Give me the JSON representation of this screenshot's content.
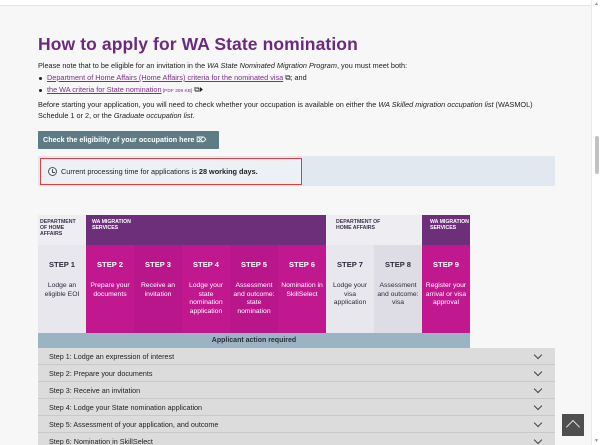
{
  "page": {
    "title": "How to apply for WA State nomination",
    "intro_text_1": "Please note that to be eligible for an invitation in the ",
    "intro_program": "WA State Nominated Migration Program",
    "intro_text_2": ", you must meet both:",
    "bullets": [
      {
        "link": "Department of Home Affairs (Home Affairs) criteria for the nominated visa",
        "suffix": " ⧉; and"
      },
      {
        "link": "the WA criteria for State nomination",
        "small": " [PDF 309 KB]",
        "suffix": " ⧉⏵"
      }
    ],
    "para2_a": "Before starting your application, you will need to check whether your occupation is available on either the ",
    "para2_list": "WA Skilled migration occupation list",
    "para2_b": " (WASMOL) Schedule 1 or 2, or the ",
    "para2_grad": "Graduate occupation list",
    "para2_c": ".",
    "check_button": "Check the eligibility of your occupation here ⌦",
    "processing_prefix": "Current processing time for applications is ",
    "processing_value": "28 working days."
  },
  "diagram": {
    "bands": [
      {
        "label": "DEPARTMENT OF HOME AFFAIRS"
      },
      {
        "label": "WA MIGRATION SERVICES"
      },
      {
        "label": "DEPARTMENT OF HOME AFFAIRS"
      },
      {
        "label": "WA MIGRATION SERVICES"
      }
    ],
    "steps": [
      {
        "step": "STEP 1",
        "desc": "Lodge an eligible EOI"
      },
      {
        "step": "STEP 2",
        "desc": "Prepare your documents"
      },
      {
        "step": "STEP 3",
        "desc": "Receive an invitation"
      },
      {
        "step": "STEP 4",
        "desc": "Lodge your state nomination application"
      },
      {
        "step": "STEP 5",
        "desc": "Assessment and outcome: state nomination"
      },
      {
        "step": "STEP 6",
        "desc": "Nomination in SkillSelect"
      },
      {
        "step": "STEP 7",
        "desc": "Lodge your visa application"
      },
      {
        "step": "STEP 8",
        "desc": "Assessment and outcome: visa"
      },
      {
        "step": "STEP 9",
        "desc": "Register your arrival or visa approval"
      }
    ],
    "action_label": "Applicant action required",
    "colors": {
      "purple": "#6d2f7a",
      "magenta": "#c2188f",
      "light": "#e8e7ee",
      "action": "#9bb4c3"
    }
  },
  "accordion": [
    "Step 1: Lodge an expression of interest",
    "Step 2: Prepare your documents",
    "Step 3: Receive an invitation",
    "Step 4: Lodge your State nomination application",
    "Step 5: Assessment of your application, and outcome",
    "Step 6: Nomination in SkillSelect"
  ],
  "icons": {
    "clock": "clock-icon",
    "chevron": "chevron-down-icon",
    "back_to_top": "arrow-up-icon"
  }
}
